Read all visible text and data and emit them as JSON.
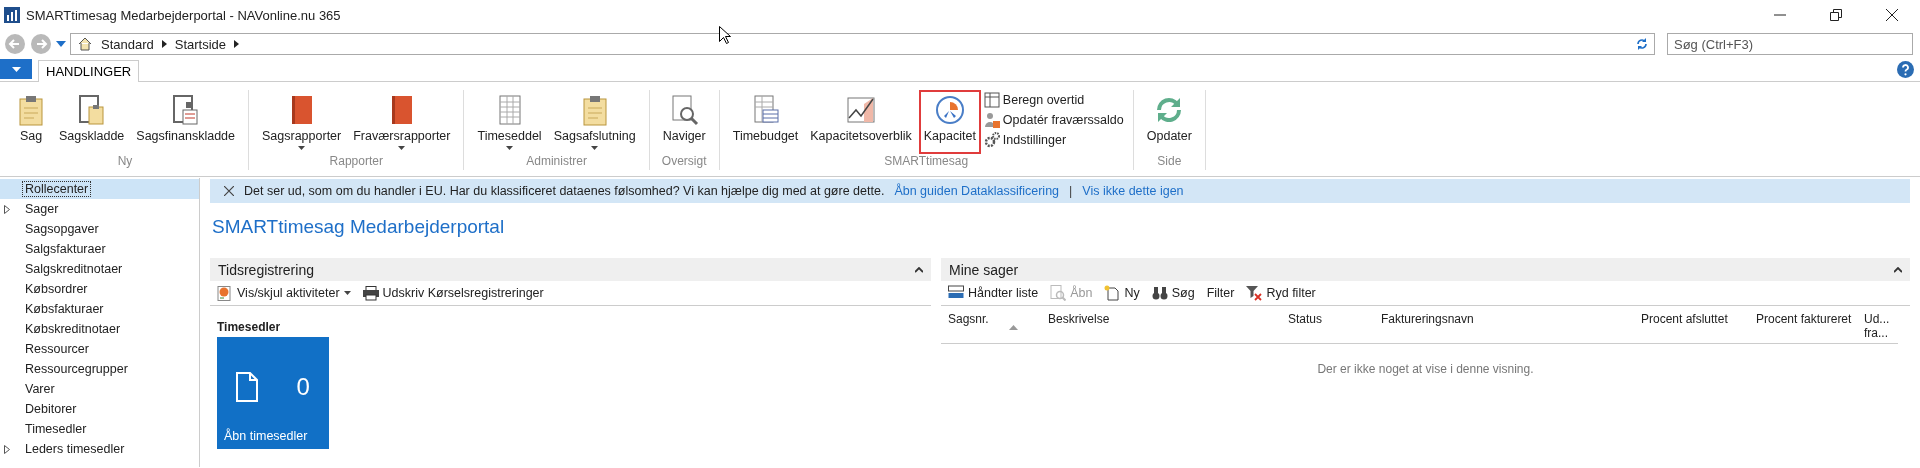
{
  "window": {
    "title": "SMARTtimesag Medarbejderportal - NAVonline.nu 365"
  },
  "address": {
    "breadcrumbs": [
      "Standard",
      "Startside"
    ]
  },
  "search": {
    "placeholder": "Søg (Ctrl+F3)"
  },
  "ribbon": {
    "tabs": [
      {
        "label": "HANDLINGER",
        "selected": true
      }
    ],
    "groups": [
      {
        "label": "Ny",
        "items": [
          {
            "label": "Sag",
            "kind": "large",
            "dropdown": false,
            "highlighted": false
          },
          {
            "label": "Sagskladde",
            "kind": "large",
            "dropdown": false,
            "highlighted": false
          },
          {
            "label": "Sagsfinanskladde",
            "kind": "large",
            "dropdown": false,
            "highlighted": false
          }
        ]
      },
      {
        "label": "Rapporter",
        "items": [
          {
            "label": "Sagsrapporter",
            "kind": "large",
            "dropdown": true,
            "highlighted": false
          },
          {
            "label": "Fraværsrapporter",
            "kind": "large",
            "dropdown": true,
            "highlighted": false
          }
        ]
      },
      {
        "label": "Administrer",
        "items": [
          {
            "label": "Timeseddel",
            "kind": "large",
            "dropdown": true,
            "highlighted": false
          },
          {
            "label": "Sagsafslutning",
            "kind": "large",
            "dropdown": true,
            "highlighted": false
          }
        ]
      },
      {
        "label": "Oversigt",
        "items": [
          {
            "label": "Naviger",
            "kind": "large",
            "dropdown": false,
            "highlighted": false
          }
        ]
      },
      {
        "label": "SMARTtimesag",
        "items": [
          {
            "label": "Timebudget",
            "kind": "large",
            "dropdown": false,
            "highlighted": false
          },
          {
            "label": "Kapacitetsoverblik",
            "kind": "large",
            "dropdown": false,
            "highlighted": false
          },
          {
            "label": "Kapacitet",
            "kind": "large",
            "dropdown": false,
            "highlighted": true
          },
          {
            "label": "Beregn overtid",
            "kind": "small"
          },
          {
            "label": "Opdatér fraværssaldo",
            "kind": "small"
          },
          {
            "label": "Indstillinger",
            "kind": "small"
          }
        ]
      },
      {
        "label": "Side",
        "items": [
          {
            "label": "Opdater",
            "kind": "large",
            "dropdown": false,
            "highlighted": false
          }
        ]
      }
    ]
  },
  "sidebar": {
    "items": [
      {
        "label": "Rollecenter",
        "selected": true,
        "expandable": false
      },
      {
        "label": "Sager",
        "selected": false,
        "expandable": true
      },
      {
        "label": "Sagsopgaver",
        "selected": false,
        "expandable": false
      },
      {
        "label": "Salgsfakturaer",
        "selected": false,
        "expandable": false
      },
      {
        "label": "Salgskreditnotaer",
        "selected": false,
        "expandable": false
      },
      {
        "label": "Købsordrer",
        "selected": false,
        "expandable": false
      },
      {
        "label": "Købsfakturaer",
        "selected": false,
        "expandable": false
      },
      {
        "label": "Købskreditnotaer",
        "selected": false,
        "expandable": false
      },
      {
        "label": "Ressourcer",
        "selected": false,
        "expandable": false
      },
      {
        "label": "Ressourcegrupper",
        "selected": false,
        "expandable": false
      },
      {
        "label": "Varer",
        "selected": false,
        "expandable": false
      },
      {
        "label": "Debitorer",
        "selected": false,
        "expandable": false
      },
      {
        "label": "Timesedler",
        "selected": false,
        "expandable": false
      },
      {
        "label": "Leders timesedler",
        "selected": false,
        "expandable": true
      }
    ]
  },
  "banner": {
    "text": "Det ser ud, som om du handler i EU. Har du klassificeret dataenes følsomhed? Vi kan hjælpe dig med at gøre dette.",
    "links": [
      "Åbn guiden Dataklassificering",
      "Vis ikke dette igen"
    ],
    "separator": "|"
  },
  "page_title": "SMARTtimesag Medarbejderportal",
  "time_panel": {
    "title": "Tidsregistrering",
    "actions": [
      {
        "label": "Vis/skjul aktiviteter",
        "dropdown": true
      },
      {
        "label": "Udskriv Kørselsregistreringer",
        "dropdown": false
      }
    ],
    "tile_group": "Timesedler",
    "tile": {
      "count": "0",
      "label": "Åbn timesedler"
    }
  },
  "cases_panel": {
    "title": "Mine sager",
    "actions": [
      {
        "label": "Håndter liste",
        "disabled": false
      },
      {
        "label": "Åbn",
        "disabled": true
      },
      {
        "label": "Ny",
        "disabled": false
      },
      {
        "label": "Søg",
        "disabled": false
      },
      {
        "label": "Filter",
        "disabled": false
      },
      {
        "label": "Ryd filter",
        "disabled": false
      }
    ],
    "table": {
      "columns": [
        {
          "label": "Sagsnr.",
          "sorted": true
        },
        {
          "label": "Beskrivelse",
          "sorted": false
        },
        {
          "label": "Status",
          "sorted": false
        },
        {
          "label": "Faktureringsnavn",
          "sorted": false
        },
        {
          "label": "Procent afsluttet",
          "sorted": false
        },
        {
          "label": "Procent faktureret",
          "sorted": false
        },
        {
          "label": "Ud... fra...",
          "sorted": false
        }
      ],
      "empty_text": "Der er ikke noget at vise i denne visning."
    }
  }
}
